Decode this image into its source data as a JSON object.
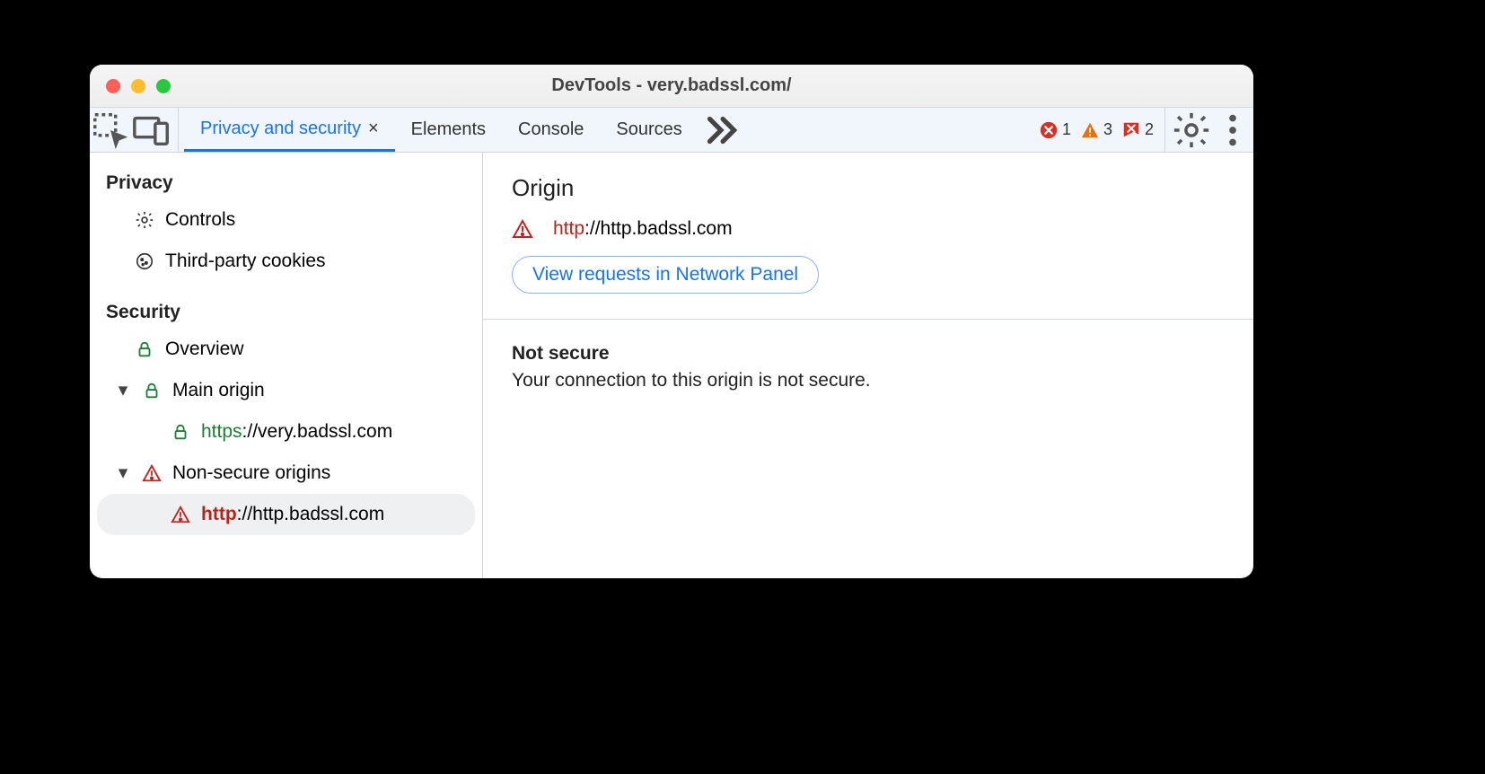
{
  "window": {
    "title": "DevTools - very.badssl.com/"
  },
  "tabs": {
    "active": "Privacy and security",
    "others": [
      "Elements",
      "Console",
      "Sources"
    ]
  },
  "status": {
    "errors": 1,
    "warnings": 3,
    "messages": 2
  },
  "sidebar": {
    "privacy": {
      "heading": "Privacy",
      "controls": "Controls",
      "cookies": "Third-party cookies"
    },
    "security": {
      "heading": "Security",
      "overview": "Overview",
      "main_origin": {
        "label": "Main origin",
        "child_scheme": "https",
        "child_rest": "://very.badssl.com"
      },
      "nonsecure": {
        "label": "Non-secure origins",
        "child_scheme": "http",
        "child_rest": "://http.badssl.com"
      }
    }
  },
  "main": {
    "origin_heading": "Origin",
    "origin_scheme": "http",
    "origin_rest": "://http.badssl.com",
    "network_link": "View requests in Network Panel",
    "status_heading": "Not secure",
    "status_body": "Your connection to this origin is not secure."
  }
}
